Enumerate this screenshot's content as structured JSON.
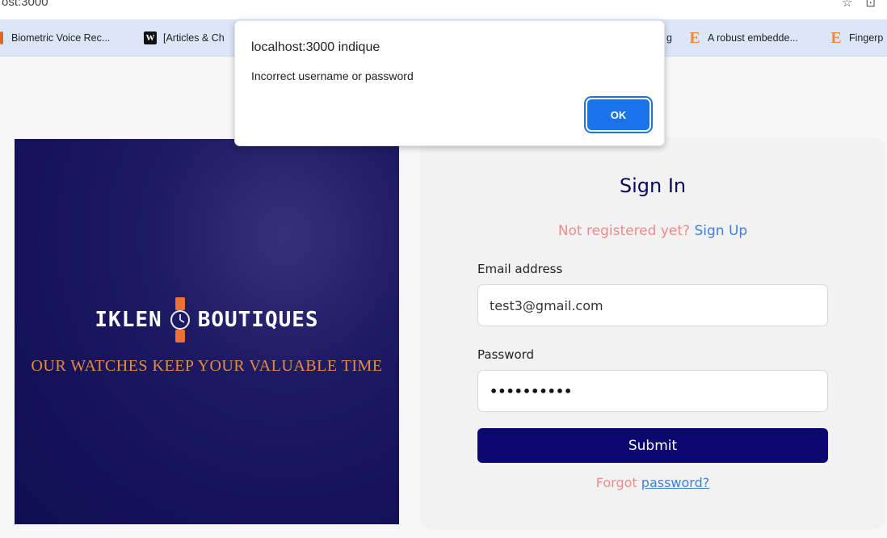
{
  "browser": {
    "address_text": "ost:3000",
    "right_icons_text": "☆ ⊡",
    "bookmarks": [
      {
        "label": "Biometric Voice Rec...",
        "icon": "orange-favicon"
      },
      {
        "label": "[Articles & Ch",
        "icon": "w-favicon"
      },
      {
        "label": "g",
        "icon": "none"
      },
      {
        "label": "A robust embedde...",
        "icon": "e-favicon"
      },
      {
        "label": "Fingerp",
        "icon": "e-favicon"
      }
    ]
  },
  "banner": {
    "brand_left": "IKLEN",
    "brand_right": "BOUTIQUES",
    "tagline": "OUR WATCHES KEEP YOUR VALUABLE TIME",
    "icon": "watch-icon"
  },
  "signin": {
    "title": "Sign In",
    "not_registered": "Not registered yet?",
    "signup_link": "Sign Up",
    "email_label": "Email address",
    "email_value": "test3@gmail.com",
    "password_label": "Password",
    "password_value": "••••••••••",
    "submit_label": "Submit",
    "forgot_text": "Forgot",
    "forgot_link": "password?"
  },
  "dialog": {
    "title": "localhost:3000 indique",
    "message": "Incorrect username or password",
    "ok_label": "OK"
  },
  "colors": {
    "brand_navy": "#0b0670",
    "accent_orange": "#e98a3c",
    "link_blue": "#3f7fe0",
    "pink_text": "#f08a8a",
    "dialog_button": "#1a73e8"
  }
}
